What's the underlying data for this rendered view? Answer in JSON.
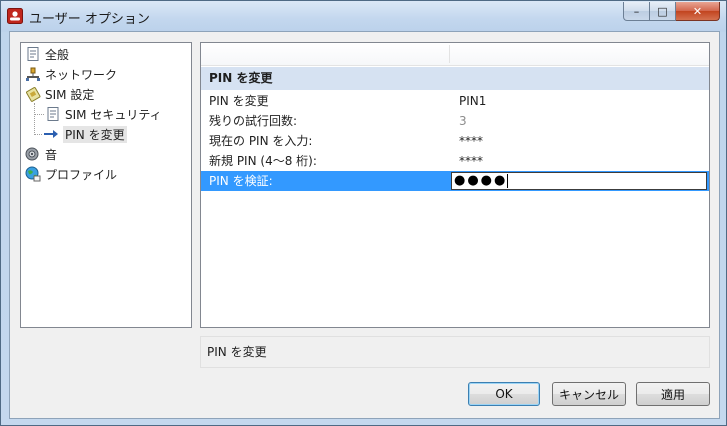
{
  "window": {
    "title": "ユーザー オプション",
    "minimize_glyph": "–",
    "maximize_glyph": "□",
    "close_glyph": "✕"
  },
  "tree": {
    "items": [
      {
        "label": "全般",
        "icon": "document-icon"
      },
      {
        "label": "ネットワーク",
        "icon": "network-icon"
      },
      {
        "label": "SIM 設定",
        "icon": "sim-card-icon"
      },
      {
        "label": "SIM セキュリティ",
        "icon": "document-icon"
      },
      {
        "label": "PIN を変更",
        "icon": "arrow-right-icon"
      },
      {
        "label": "音",
        "icon": "speaker-icon"
      },
      {
        "label": "プロファイル",
        "icon": "globe-profile-icon"
      }
    ],
    "selected": "PIN を変更"
  },
  "panel": {
    "section_title": "PIN を変更",
    "rows": [
      {
        "label": "PIN を変更",
        "value": "PIN1"
      },
      {
        "label": "残りの試行回数:",
        "value": "3"
      },
      {
        "label": "現在の PIN を入力:",
        "value": "****"
      },
      {
        "label": "新規 PIN (4～8 桁):",
        "value": "****"
      },
      {
        "label": "PIN を検証:",
        "value": "●●●●"
      }
    ]
  },
  "description": "PIN を変更",
  "buttons": {
    "ok": "OK",
    "cancel": "キャンセル",
    "apply": "適用"
  },
  "colors": {
    "selection": "#3399ff",
    "section_bg": "#d6e2f2",
    "close_button": "#c2441f"
  }
}
